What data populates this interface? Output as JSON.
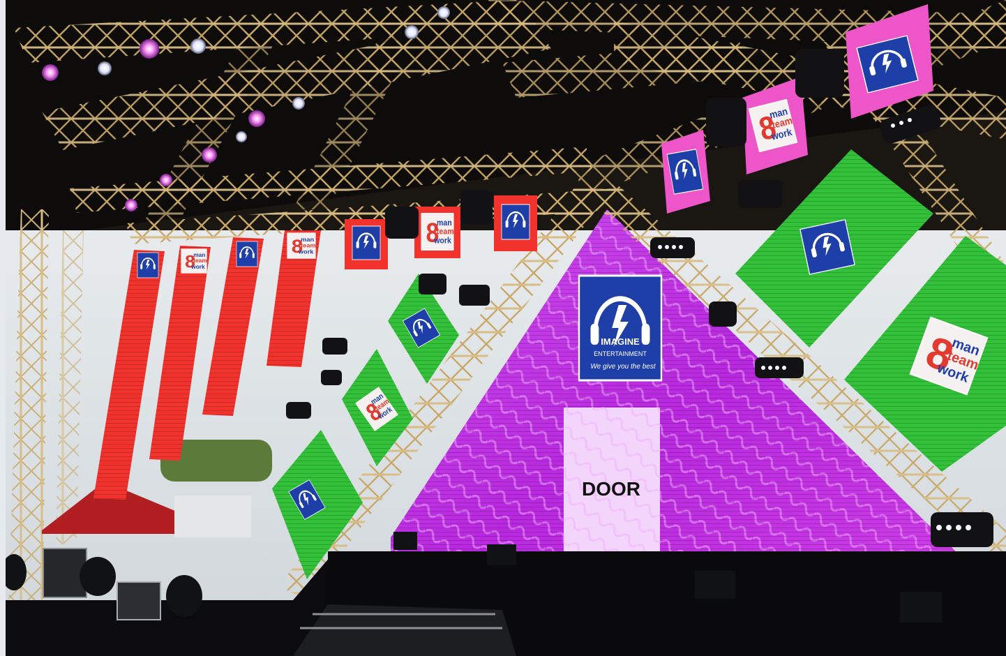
{
  "scene": {
    "colors": {
      "pyramid_magenta": "#c430e6",
      "pyramid_magenta_light": "#e07af5",
      "panel_red": "#f2332d",
      "panel_green": "#34c13a",
      "panel_pink": "#ee55c8",
      "logo_blue": "#1f3fa8",
      "truss_gold": "#c9a86a",
      "stage_black": "#0c0c10",
      "sky": "#e8ecef"
    }
  },
  "logo_imagine": {
    "name": "IMAGINE",
    "subtitle": "ENTERTAINMENT",
    "tagline": "We give you the best"
  },
  "logo_8man": {
    "numeral": "8",
    "line1": "man",
    "line2": "team",
    "line3": "work"
  },
  "door": {
    "label": "DOOR"
  }
}
